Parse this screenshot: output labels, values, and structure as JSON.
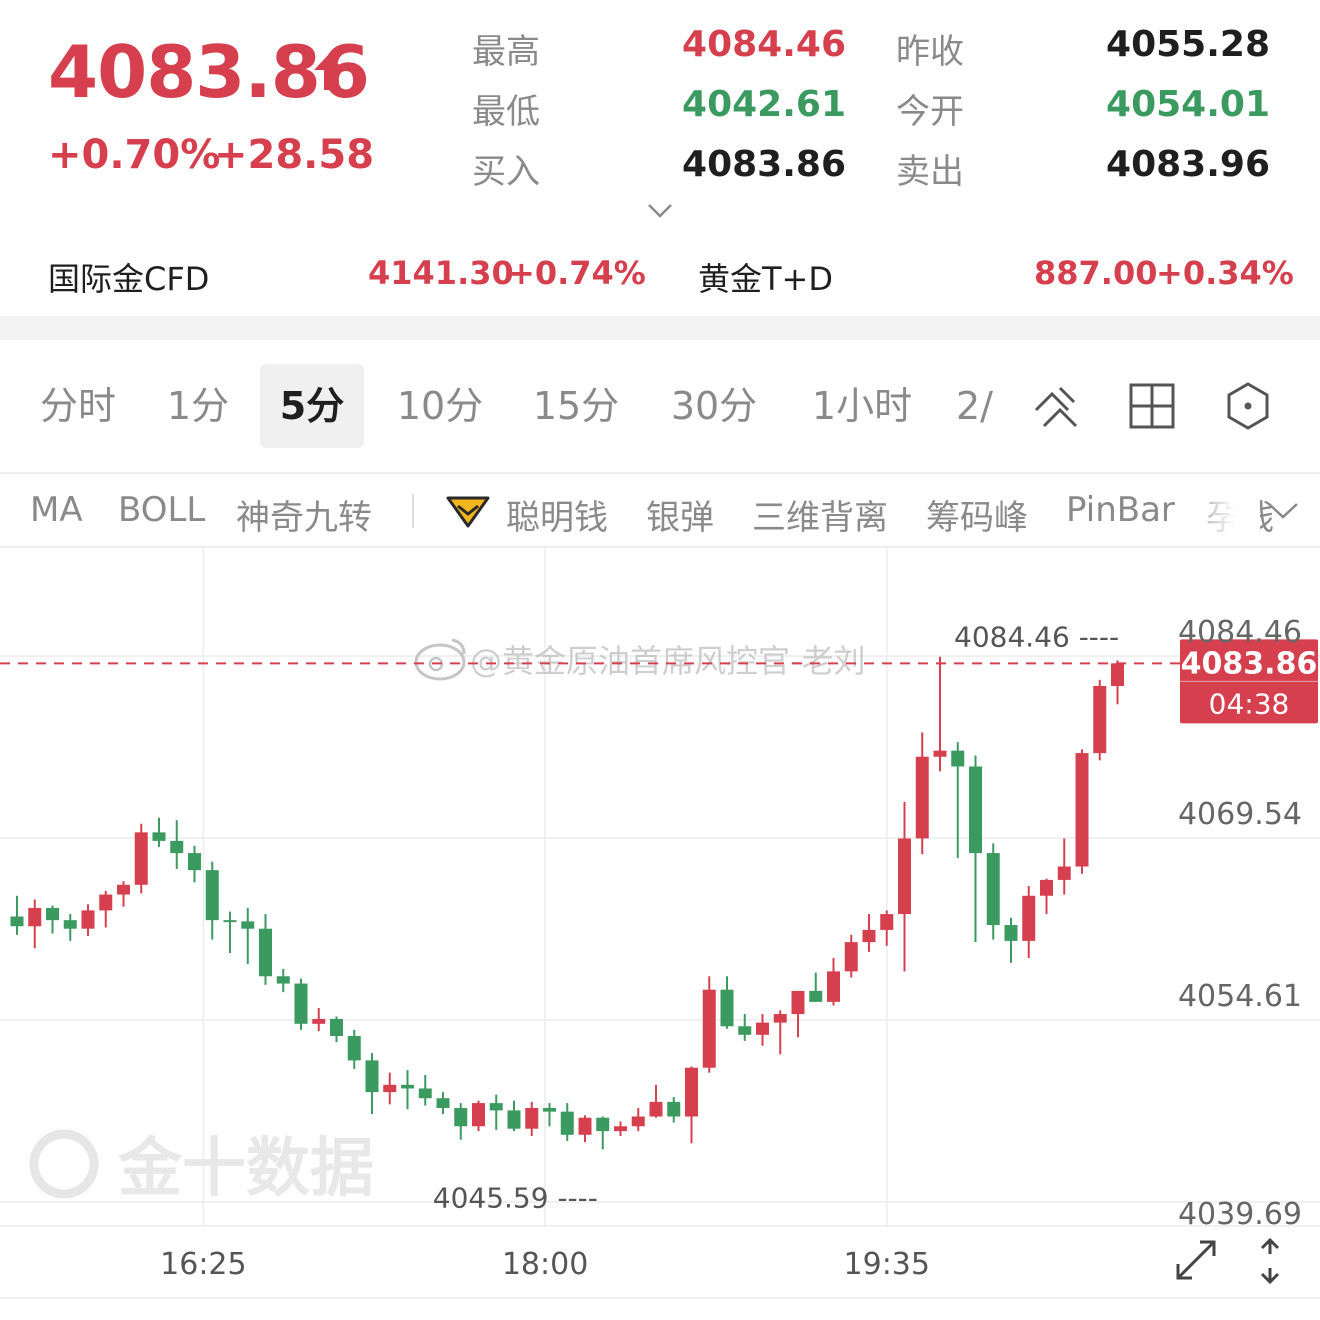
{
  "quote": {
    "last_price": "4083.86",
    "change_pct": "+0.70%",
    "change_abs": "+28.58",
    "stats": [
      {
        "label": "最高",
        "value": "4084.46",
        "tone": "up"
      },
      {
        "label": "昨收",
        "value": "4055.28",
        "tone": "dark"
      },
      {
        "label": "最低",
        "value": "4042.61",
        "tone": "down"
      },
      {
        "label": "今开",
        "value": "4054.01",
        "tone": "down"
      },
      {
        "label": "买入",
        "value": "4083.86",
        "tone": "dark"
      },
      {
        "label": "卖出",
        "value": "4083.96",
        "tone": "dark"
      }
    ],
    "refs": [
      {
        "name": "国际金CFD",
        "price": "4141.30",
        "pct": "+0.74%"
      },
      {
        "name": "黄金T+D",
        "price": "887.00",
        "pct": "+0.34%"
      }
    ]
  },
  "periods": {
    "tabs": [
      "分时",
      "1分",
      "5分",
      "10分",
      "15分",
      "30分",
      "1小时",
      "2/"
    ],
    "active": "5分"
  },
  "indicators": [
    "MA",
    "BOLL",
    "神奇九转",
    "聪明钱",
    "银弹",
    "三维背离",
    "筹码峰",
    "PinBar",
    "孕线"
  ],
  "watermarks": {
    "weibo": "@黄金原油首席风控官-老刘",
    "brand": "金十数据"
  },
  "colors": {
    "up": "#d6404e",
    "down": "#3a9a60",
    "grid": "#ececec",
    "price_line": "#d6404e"
  },
  "chart_data": {
    "type": "candlestick",
    "interval": "5分",
    "ylim": [
      4039.69,
      4084.46
    ],
    "y_ticks": [
      "4084.46",
      "4069.54",
      "4054.61",
      "4039.69"
    ],
    "x_ticks": [
      "16:25",
      "18:00",
      "19:35"
    ],
    "current_price": "4083.86",
    "countdown": "04:38",
    "high_label": "4084.46",
    "low_label": "4045.59",
    "candles": [
      [
        4063.1,
        4064.8,
        4061.6,
        4062.3
      ],
      [
        4062.3,
        4064.5,
        4060.5,
        4063.8
      ],
      [
        4063.8,
        4064.0,
        4061.7,
        4062.8
      ],
      [
        4062.8,
        4063.3,
        4061.1,
        4062.1
      ],
      [
        4062.1,
        4064.1,
        4061.5,
        4063.6
      ],
      [
        4063.6,
        4065.2,
        4062.2,
        4064.9
      ],
      [
        4064.9,
        4066.0,
        4063.9,
        4065.7
      ],
      [
        4065.7,
        4070.7,
        4065.0,
        4070.0
      ],
      [
        4070.0,
        4071.2,
        4068.8,
        4069.3
      ],
      [
        4069.3,
        4071.0,
        4067.0,
        4068.3
      ],
      [
        4068.3,
        4068.9,
        4065.9,
        4066.9
      ],
      [
        4066.9,
        4067.6,
        4061.2,
        4062.8
      ],
      [
        4062.8,
        4063.5,
        4060.1,
        4062.7
      ],
      [
        4062.7,
        4063.8,
        4059.2,
        4062.1
      ],
      [
        4062.1,
        4063.3,
        4057.5,
        4058.2
      ],
      [
        4058.2,
        4058.8,
        4056.9,
        4057.6
      ],
      [
        4057.6,
        4058.0,
        4053.8,
        4054.3
      ],
      [
        4054.3,
        4055.6,
        4053.7,
        4054.7
      ],
      [
        4054.7,
        4054.9,
        4052.8,
        4053.3
      ],
      [
        4053.3,
        4053.8,
        4050.6,
        4051.3
      ],
      [
        4051.3,
        4051.9,
        4046.9,
        4048.7
      ],
      [
        4048.7,
        4050.3,
        4047.7,
        4049.3
      ],
      [
        4049.3,
        4050.5,
        4047.3,
        4049.0
      ],
      [
        4049.0,
        4050.1,
        4047.6,
        4048.2
      ],
      [
        4048.2,
        4048.7,
        4046.9,
        4047.4
      ],
      [
        4047.4,
        4047.8,
        4044.8,
        4045.9
      ],
      [
        4045.9,
        4048.0,
        4045.5,
        4047.8
      ],
      [
        4047.8,
        4048.5,
        4045.6,
        4047.2
      ],
      [
        4047.2,
        4048.0,
        4045.5,
        4045.7
      ],
      [
        4045.7,
        4047.9,
        4045.1,
        4047.4
      ],
      [
        4047.4,
        4047.8,
        4045.9,
        4047.1
      ],
      [
        4047.1,
        4047.8,
        4044.7,
        4045.2
      ],
      [
        4045.2,
        4046.8,
        4044.6,
        4046.6
      ],
      [
        4046.6,
        4046.7,
        4044.0,
        4045.5
      ],
      [
        4045.5,
        4046.3,
        4045.1,
        4045.9
      ],
      [
        4045.9,
        4047.4,
        4045.5,
        4046.7
      ],
      [
        4046.7,
        4049.3,
        4046.6,
        4047.9
      ],
      [
        4047.9,
        4048.3,
        4046.2,
        4046.7
      ],
      [
        4046.7,
        4050.8,
        4044.5,
        4050.7
      ],
      [
        4050.7,
        4058.2,
        4050.3,
        4057.1
      ],
      [
        4057.1,
        4058.2,
        4053.9,
        4054.1
      ],
      [
        4054.1,
        4055.1,
        4052.9,
        4053.4
      ],
      [
        4053.4,
        4055.1,
        4052.5,
        4054.4
      ],
      [
        4054.4,
        4055.4,
        4051.8,
        4055.1
      ],
      [
        4055.1,
        4056.2,
        4053.2,
        4057.0
      ],
      [
        4057.0,
        4058.5,
        4056.1,
        4056.1
      ],
      [
        4056.1,
        4059.7,
        4055.8,
        4058.6
      ],
      [
        4058.6,
        4061.6,
        4058.1,
        4061.0
      ],
      [
        4061.0,
        4063.3,
        4060.2,
        4062.0
      ],
      [
        4062.0,
        4063.6,
        4060.7,
        4063.3
      ],
      [
        4063.3,
        4072.5,
        4058.6,
        4069.5
      ],
      [
        4069.5,
        4078.2,
        4068.2,
        4076.2
      ],
      [
        4076.2,
        4084.4,
        4075.0,
        4076.7
      ],
      [
        4076.7,
        4077.4,
        4067.9,
        4075.4
      ],
      [
        4075.4,
        4076.3,
        4061.0,
        4068.3
      ],
      [
        4068.3,
        4069.1,
        4061.2,
        4062.4
      ],
      [
        4062.4,
        4063.0,
        4059.3,
        4061.1
      ],
      [
        4061.1,
        4065.6,
        4059.7,
        4064.8
      ],
      [
        4064.8,
        4066.2,
        4063.3,
        4066.1
      ],
      [
        4066.1,
        4069.5,
        4064.9,
        4067.2
      ],
      [
        4067.2,
        4076.8,
        4066.6,
        4076.5
      ],
      [
        4076.5,
        4082.5,
        4075.9,
        4082.0
      ],
      [
        4082.0,
        4084.1,
        4080.5,
        4083.86
      ]
    ]
  }
}
